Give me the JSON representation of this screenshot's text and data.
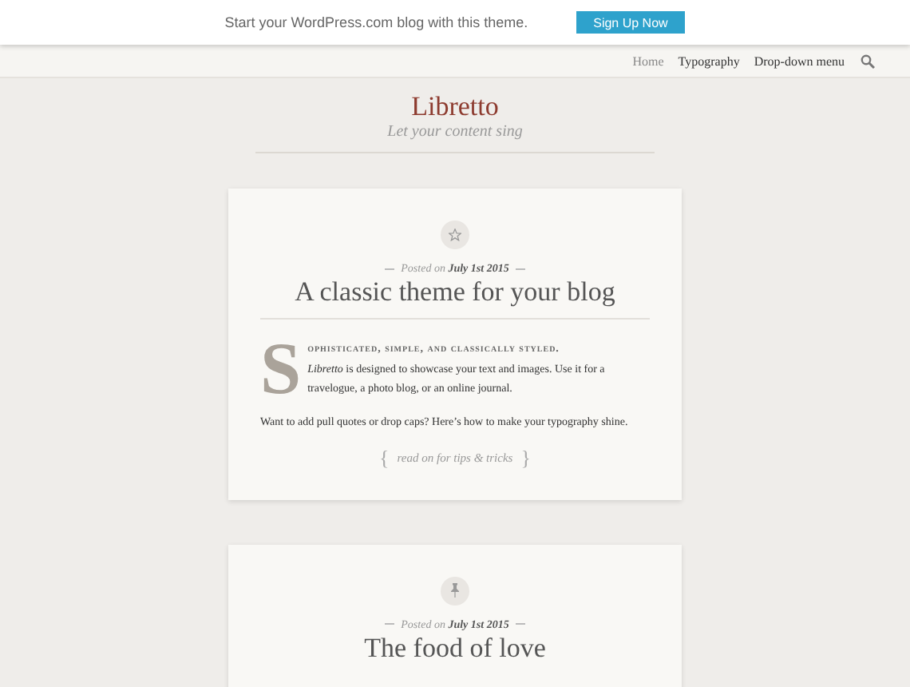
{
  "promo_bar": {
    "text": "Start your WordPress.com blog with this theme.",
    "button": "Sign Up Now"
  },
  "nav": {
    "items": [
      {
        "label": "Home",
        "selected": true
      },
      {
        "label": "Typography",
        "selected": false
      },
      {
        "label": "Drop-down menu",
        "selected": false
      }
    ]
  },
  "site": {
    "title": "Libretto",
    "tagline": "Let your content sing"
  },
  "posts": [
    {
      "kind": "star",
      "posted_label": "Posted on",
      "date": "July 1st 2015",
      "title": "A classic theme for your blog",
      "drop_cap": "S",
      "lead": "ophisticated, simple, and classically styled.",
      "intro": "*Libretto* is designed to showcase your text and images. Use it for a travelogue, a photo blog, or an online journal.",
      "paragraph": "Want to add pull quotes or drop caps? Here’s how to make your typography shine.",
      "more": "read on for tips & tricks",
      "brace_open": "{",
      "brace_close": "}"
    },
    {
      "kind": "pin",
      "posted_label": "Posted on",
      "date": "July 1st 2015",
      "title": "The food of love"
    }
  ]
}
